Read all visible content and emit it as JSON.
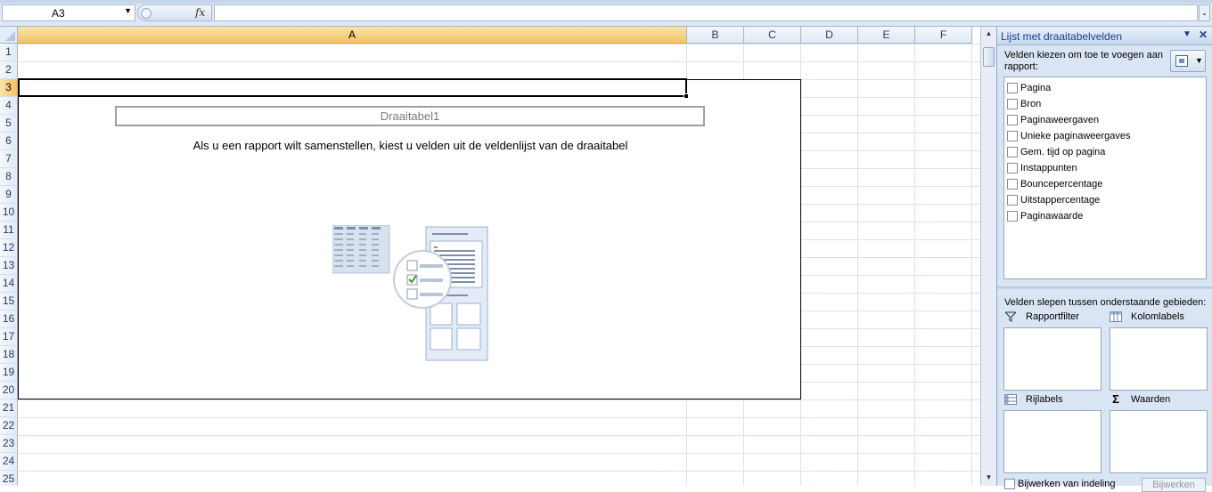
{
  "formula_bar": {
    "name_box": "A3",
    "fx_label": "fx",
    "formula_value": ""
  },
  "columns": [
    {
      "label": "A",
      "selected": true
    },
    {
      "label": "B",
      "selected": false
    },
    {
      "label": "C",
      "selected": false
    },
    {
      "label": "D",
      "selected": false
    },
    {
      "label": "E",
      "selected": false
    },
    {
      "label": "F",
      "selected": false
    }
  ],
  "rows": [
    "1",
    "2",
    "3",
    "4",
    "5",
    "6",
    "7",
    "8",
    "9",
    "10",
    "11",
    "12",
    "13",
    "14",
    "15",
    "16",
    "17",
    "18",
    "19",
    "20",
    "21",
    "22",
    "23",
    "24",
    "25"
  ],
  "selected_row": "3",
  "pivot": {
    "title": "Draaitabel1",
    "instruction": "Als u een rapport wilt samenstellen, kiest u velden uit de veldenlijst van de draaitabel"
  },
  "field_list": {
    "title": "Lijst met draaitabelvelden",
    "choose_label": "Velden kiezen om toe te voegen aan rapport:",
    "fields": [
      "Pagina",
      "Bron",
      "Paginaweergaven",
      "Unieke paginaweergaves",
      "Gem. tijd op pagina",
      "Instappunten",
      "Bouncepercentage",
      "Uitstappercentage",
      "Paginawaarde"
    ],
    "drag_label": "Velden slepen tussen onderstaande gebieden:",
    "zones": {
      "report_filter": "Rapportfilter",
      "column_labels": "Kolomlabels",
      "row_labels": "Rijlabels",
      "values": "Waarden"
    },
    "defer_label": "Bijwerken van indeling",
    "update_button": "Bijwerken"
  }
}
